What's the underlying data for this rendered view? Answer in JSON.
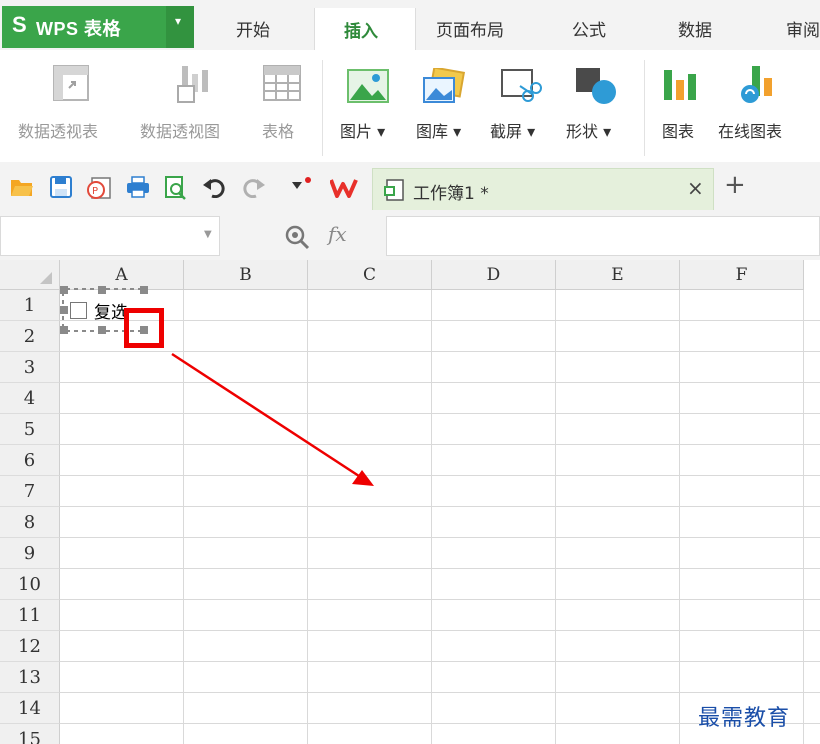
{
  "app": {
    "logo": "S",
    "title": "WPS 表格",
    "menu_arrow": "▾"
  },
  "tabs": [
    {
      "label": "开始",
      "active": false
    },
    {
      "label": "插入",
      "active": true
    },
    {
      "label": "页面布局",
      "active": false
    },
    {
      "label": "公式",
      "active": false
    },
    {
      "label": "数据",
      "active": false
    },
    {
      "label": "审阅",
      "active": false
    }
  ],
  "ribbon": {
    "pivot_table": {
      "label": "数据透视表",
      "icon": "pivot-table-icon",
      "enabled": false
    },
    "pivot_chart": {
      "label": "数据透视图",
      "icon": "pivot-chart-icon",
      "enabled": false
    },
    "table": {
      "label": "表格",
      "icon": "table-icon",
      "enabled": false
    },
    "picture": {
      "label": "图片 ▾",
      "icon": "picture-icon"
    },
    "gallery": {
      "label": "图库 ▾",
      "icon": "gallery-icon"
    },
    "screenshot": {
      "label": "截屏 ▾",
      "icon": "screenshot-icon"
    },
    "shapes": {
      "label": "形状 ▾",
      "icon": "shapes-icon"
    },
    "chart": {
      "label": "图表",
      "icon": "chart-icon"
    },
    "online_chart": {
      "label": "在线图表",
      "icon": "online-chart-icon"
    }
  },
  "quick_access": {
    "icons": [
      "open-folder-icon",
      "save-icon",
      "export-pdf-icon",
      "print-icon",
      "print-preview-icon",
      "undo-icon",
      "redo-icon",
      "customize-icon"
    ],
    "doc_tab": {
      "name": "工作簿1 *",
      "close": "×"
    },
    "new_tab": "+"
  },
  "formula_bar": {
    "namebox_value": "",
    "fx_label": "fx",
    "formula_value": ""
  },
  "grid": {
    "columns": [
      "A",
      "B",
      "C",
      "D",
      "E",
      "F"
    ],
    "rows": [
      "1",
      "2",
      "3",
      "4",
      "5",
      "6",
      "7",
      "8",
      "9",
      "10",
      "11",
      "12",
      "13",
      "14",
      "15"
    ]
  },
  "checkbox_control": {
    "label": "复选",
    "checked": false
  },
  "watermark": "最需教育",
  "colors": {
    "brand_green": "#3aa54a",
    "active_tab_text": "#2f8a3b",
    "annotation_red": "#ee0000",
    "watermark_blue": "#1a4ea8"
  }
}
